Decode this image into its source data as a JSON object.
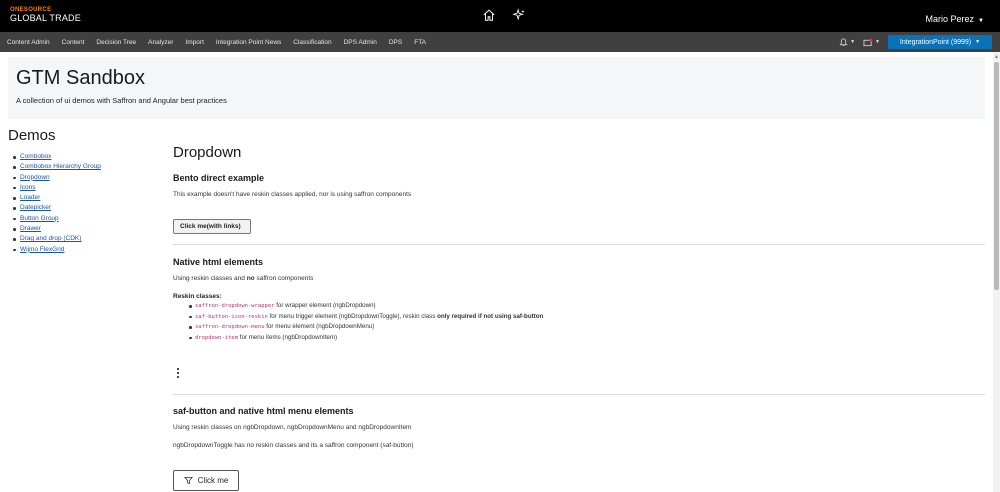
{
  "header": {
    "brand_small": "ONESOURCE",
    "brand_big": "GLOBAL TRADE",
    "user_name": "Mario Perez",
    "icons": [
      "home-icon",
      "sparkle-icon"
    ]
  },
  "nav": {
    "items": [
      "Content Admin",
      "Content",
      "Decision Tree",
      "Analyzer",
      "Import",
      "Integration Point News",
      "Classification",
      "DPS Admin",
      "DPS",
      "FTA"
    ],
    "integration_button": "IntegrationPoint (9999)",
    "icons": [
      "bell-icon",
      "inbox-icon"
    ]
  },
  "hero": {
    "title": "GTM Sandbox",
    "subtitle": "A collection of ui demos with Saffron and Angular best practices"
  },
  "sidebar": {
    "title": "Demos",
    "items": [
      "Combobox",
      "Combobox Hierarchy Group",
      "Dropdown",
      "Icons",
      "Loader",
      "Datepicker",
      "Button Group",
      "Drawer",
      "Drag and drop (CDK)",
      "Wijmo FlexGrid"
    ]
  },
  "main": {
    "title": "Dropdown",
    "bento": {
      "title": "Bento direct example",
      "desc": "This example doesn't have reskin classes applied, nor is using saffron components",
      "button": "Click me(with links)"
    },
    "native": {
      "title": "Native html elements",
      "desc_before": "Using reskin classes and ",
      "desc_bold": "no",
      "desc_after": " saffron components",
      "reskin_label": "Reskin classes:",
      "items": [
        {
          "code": "saffron-dropdown-wrapper",
          "text": " for wrapper element (ngbDropdown)",
          "bold": "",
          "tail": ""
        },
        {
          "code": "saf-button-icon-reskin",
          "text": " for menu trigger element (ngbDropdownToggle), reskin class ",
          "bold": "only required if not using saf-button",
          "tail": ""
        },
        {
          "code": "saffron-dropdown-menu",
          "text": " for menu element (ngbDropdownMenu)",
          "bold": "",
          "tail": ""
        },
        {
          "code": "dropdown-item",
          "text": " for menu items (ngbDropdownItem)",
          "bold": "",
          "tail": ""
        }
      ]
    },
    "safbutton": {
      "title": "saf-button and native html menu elements",
      "desc1": "Using reskin classes on ngbDropdown, ngbDropdownMenu and ngbDropdownItem",
      "desc2": "ngbDropdownToggle has no reskin classes and its a saffron component (saf-button)",
      "button": "Click me"
    }
  }
}
